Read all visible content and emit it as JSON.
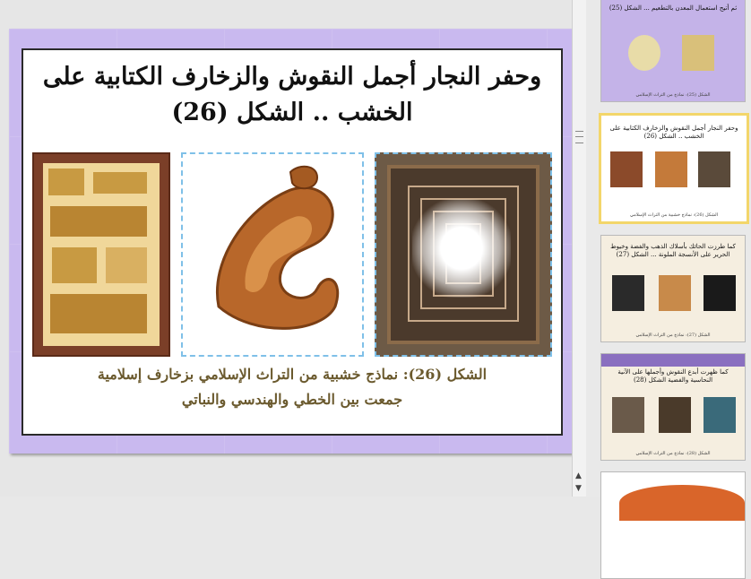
{
  "slide": {
    "title": "وحفر النجار أجمل النقوش والزخارف الكتابية على الخشب .. الشكل (26)",
    "caption_line1": "الشكل (26): نماذج خشبية من التراث الإسلامي بزخارف إسلامية",
    "caption_line2": "جمعت بين الخطي والهندسي والنباتي",
    "images": [
      {
        "name": "wooden-calligraphy-panel-square"
      },
      {
        "name": "carved-muhammad-calligraphy"
      },
      {
        "name": "kufic-square-panel"
      }
    ]
  },
  "thumbnails": [
    {
      "number": "",
      "text": "ثم أتيح استعمال المعدن بالتطعيم ... الشكل (25)",
      "caption": "الشكل (25): نماذج من التراث الإسلامي"
    },
    {
      "number": "",
      "text": "وحفر النجار أجمل النقوش والزخارف الكتابية على الخشب .. الشكل (26)",
      "caption": "الشكل (26): نماذج خشبية من التراث الإسلامي"
    },
    {
      "number": "",
      "text": "كما طرزت الحائك بأسلاك الذهب والفضة وخيوط الحرير على الأنسجة الملونة ... الشكل (27)",
      "caption": "الشكل (27): نماذج من التراث الإسلامي"
    },
    {
      "number": "",
      "text": "كما ظهرت أبدع النقوش وأجملها على الآنية النحاسية والفضية الشكل (28)",
      "caption": "الشكل (28): نماذج من التراث الإسلامي"
    },
    {
      "number": "",
      "text": "",
      "caption": ""
    }
  ],
  "colors": {
    "slide_bg": "#c9b9ef",
    "selected_thumb_border": "#f3d66a",
    "caption_text": "#6b5a2e"
  }
}
